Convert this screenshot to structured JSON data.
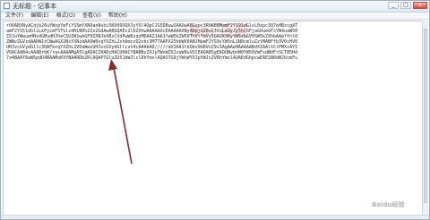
{
  "window": {
    "title": "无标题 - 记事本",
    "controls": {
      "minimize": "_",
      "maximize": "□",
      "close": "x"
    }
  },
  "menu": [
    "文件(F)",
    "编辑(E)",
    "格式(O)",
    "查看(V)",
    "帮助(H)"
  ],
  "watermark": "Bai 百度",
  "content": {
    "lines": [
      "rO0ABXNyACdjb20uYWxpYmFiYS5mYXN0anNvbi5KU09OQXJyYXl4OpCJG5DBuwIAAUwABGxpc3R0ABBMamF2YS91dGlsL0xpc3Q7eHBzcgAT",
      "amF2YS51dGlsLkFycmF5TGlzdHiB0h2Zx2GdAwABSQAEc2l6ZXhwAAAAAXcEAAAAAXNyADpjb20uc3VuLm9yZy5hcGFjaGUueGFsYW4uaW50",
      "ZXJuYWwueHNsdGMudHJheC5UZW1wbGF0ZXNJbXBsCVdPwW6sqzMDAAZJAA1faW5kZW50TnVtYmVySQAOX3RyYW5zbGV0SW5kZXhbAApfYnl0",
      "ZWNvZGVzdAADW1tCWwAGX2NsYXNzdAASW0xqYXZhL2xhbmcvQ2xhc3M7TAAFX25hbWV0ABJMamF2YS9sYW5nL1N0cmluZztMABFfb3V0cHV0",
      "UHJvcGVydGllc3QAFkxqYXZhL3V0aWwvUHJvcGVydGllczt4cAAAAAD/////dXIAA1tbQkv9GRVnZ9s3AgAAeHAAAAABdXIAAltCrPMX+AYI",
      "VOACAAB4cAAABrbK/rq+AAAAMgA5CgADACIHADcHACUHACYBABBzZXJpYWxWZXJzaW9uVUlEAQABSgEADUNvbnN0YW50VmFsdWUFrSCT85Hd",
      "7z4BAAY8aW5pdD4BAAMoKVYBAARDb2RlAQAPTGluZU51bWJlclRhYmxlAQASTG9jYWxWYXJpYWJsZVRhYmxlAQAEdGhpcwEAE1N0dWJUcmFu"
    ]
  },
  "annotation": {
    "arrow_color": "#8b2a2a"
  },
  "corner_watermark": "Baidu经验"
}
